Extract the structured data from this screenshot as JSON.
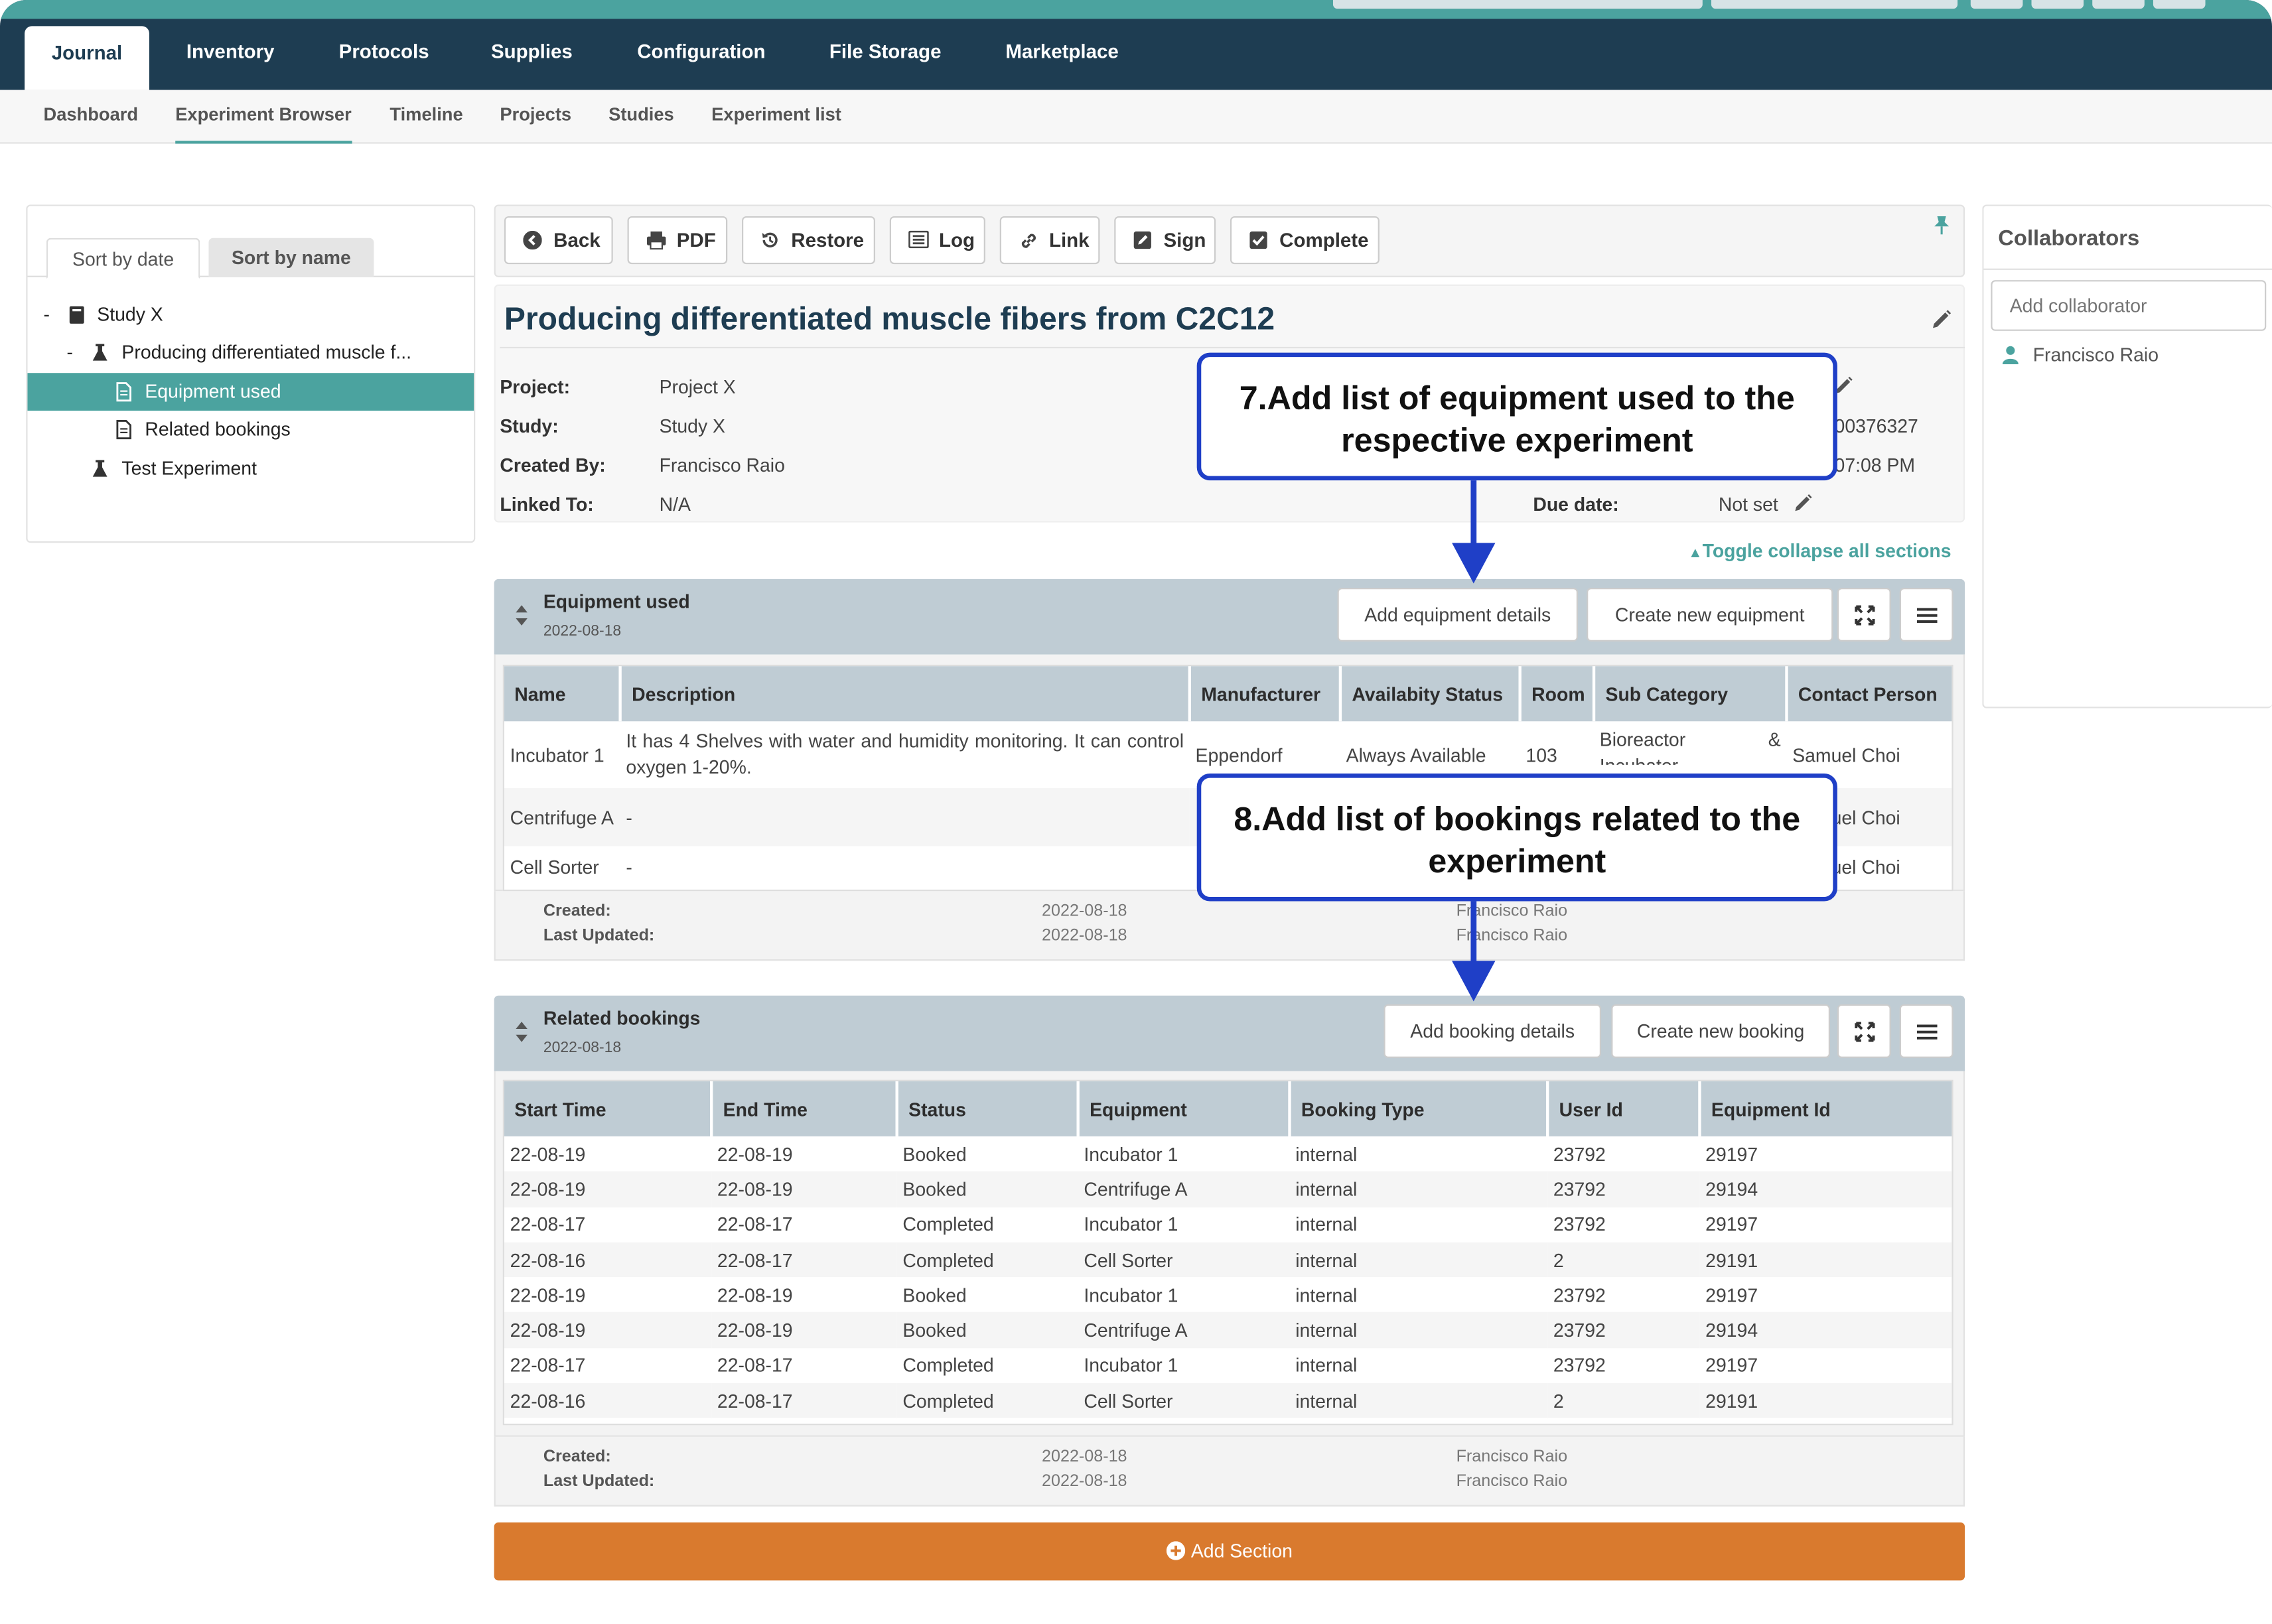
{
  "nav": {
    "tabs": [
      {
        "label": "Journal",
        "active": true
      },
      {
        "label": "Inventory"
      },
      {
        "label": "Protocols"
      },
      {
        "label": "Supplies"
      },
      {
        "label": "Configuration"
      },
      {
        "label": "File Storage"
      },
      {
        "label": "Marketplace"
      }
    ]
  },
  "subnav": {
    "tabs": [
      {
        "label": "Dashboard"
      },
      {
        "label": "Experiment Browser",
        "active": true
      },
      {
        "label": "Timeline"
      },
      {
        "label": "Projects"
      },
      {
        "label": "Studies"
      },
      {
        "label": "Experiment list"
      }
    ]
  },
  "sidebar": {
    "sort_by_date": "Sort by date",
    "sort_by_name": "Sort by name",
    "tree": [
      {
        "toggle": "-",
        "label": "Study X",
        "icon": "book-icon"
      },
      {
        "toggle": "-",
        "label": "Producing differentiated muscle f...",
        "icon": "flask-icon"
      },
      {
        "label": "Equipment used",
        "icon": "document-icon",
        "selected": true
      },
      {
        "label": "Related bookings",
        "icon": "document-icon"
      },
      {
        "label": "Test Experiment",
        "icon": "flask-icon"
      }
    ]
  },
  "toolbar": {
    "back": "Back",
    "pdf": "PDF",
    "restore": "Restore",
    "log": "Log",
    "link": "Link",
    "sign": "Sign",
    "complete": "Complete"
  },
  "experiment": {
    "title": "Producing differentiated muscle fibers from C2C12",
    "project_label": "Project:",
    "project": "Project X",
    "study_label": "Study:",
    "study": "Study X",
    "created_by_label": "Created By:",
    "created_by": "Francisco Raio",
    "linked_to_label": "Linked To:",
    "linked_to": "N/A",
    "id_partial": "00376327",
    "time_partial": "07:08 PM",
    "due_date_label": "Due date:",
    "due_date": "Not set",
    "toggle_collapse": "Toggle collapse all sections"
  },
  "equipment_section": {
    "title": "Equipment used",
    "date": "2022-08-18",
    "add_details": "Add equipment details",
    "create_new": "Create new equipment",
    "columns": [
      "Name",
      "Description",
      "Manufacturer",
      "Availabity Status",
      "Room",
      "Sub Category",
      "Contact Person"
    ],
    "rows": [
      {
        "name": "Incubator 1",
        "description": "It has 4 Shelves with water and humidity monitoring. It can control oxygen 1-20%.",
        "manufacturer": "Eppendorf",
        "status": "Always Available",
        "room": "103",
        "sub_category": "Bioreactor & Incubator",
        "contact": "Samuel Choi"
      },
      {
        "name": "Centrifuge A",
        "description": "-",
        "manufacturer": "",
        "status": "",
        "room": "",
        "sub_category": "",
        "contact": "Samuel Choi"
      },
      {
        "name": "Cell Sorter",
        "description": "-",
        "manufacturer": "",
        "status": "",
        "room": "",
        "sub_category": "",
        "contact": "Samuel Choi"
      }
    ],
    "created_label": "Created:",
    "created_date": "2022-08-18",
    "created_by": "Francisco Raio",
    "updated_label": "Last Updated:",
    "updated_date": "2022-08-18",
    "updated_by": "Francisco Raio"
  },
  "bookings_section": {
    "title": "Related bookings",
    "date": "2022-08-18",
    "add_details": "Add booking details",
    "create_new": "Create new booking",
    "columns": [
      "Start Time",
      "End Time",
      "Status",
      "Equipment",
      "Booking Type",
      "User Id",
      "Equipment Id"
    ],
    "rows": [
      [
        "22-08-19",
        "22-08-19",
        "Booked",
        "Incubator 1",
        "internal",
        "23792",
        "29197"
      ],
      [
        "22-08-19",
        "22-08-19",
        "Booked",
        "Centrifuge A",
        "internal",
        "23792",
        "29194"
      ],
      [
        "22-08-17",
        "22-08-17",
        "Completed",
        "Incubator 1",
        "internal",
        "23792",
        "29197"
      ],
      [
        "22-08-16",
        "22-08-17",
        "Completed",
        "Cell Sorter",
        "internal",
        "2",
        "29191"
      ],
      [
        "22-08-19",
        "22-08-19",
        "Booked",
        "Incubator 1",
        "internal",
        "23792",
        "29197"
      ],
      [
        "22-08-19",
        "22-08-19",
        "Booked",
        "Centrifuge A",
        "internal",
        "23792",
        "29194"
      ],
      [
        "22-08-17",
        "22-08-17",
        "Completed",
        "Incubator 1",
        "internal",
        "23792",
        "29197"
      ],
      [
        "22-08-16",
        "22-08-17",
        "Completed",
        "Cell Sorter",
        "internal",
        "2",
        "29191"
      ]
    ],
    "created_label": "Created:",
    "created_date": "2022-08-18",
    "created_by": "Francisco Raio",
    "updated_label": "Last Updated:",
    "updated_date": "2022-08-18",
    "updated_by": "Francisco Raio"
  },
  "add_section": "Add Section",
  "collaborators": {
    "title": "Collaborators",
    "placeholder": "Add collaborator",
    "members": [
      "Francisco Raio"
    ]
  },
  "callouts": {
    "c7": "7.Add list of equipment used to the respective experiment",
    "c7_line1": "7.Add list of equipment used to the",
    "c7_line2": "respective experiment",
    "c8_line1": "8.Add list of bookings related to the",
    "c8_line2": "experiment"
  },
  "colors": {
    "navbar": "#1e3d52",
    "teal_accent": "#4ba39f",
    "section_header": "#bfccd4",
    "add_section": "#d97a2e",
    "callout_border": "#1f3fc7"
  }
}
